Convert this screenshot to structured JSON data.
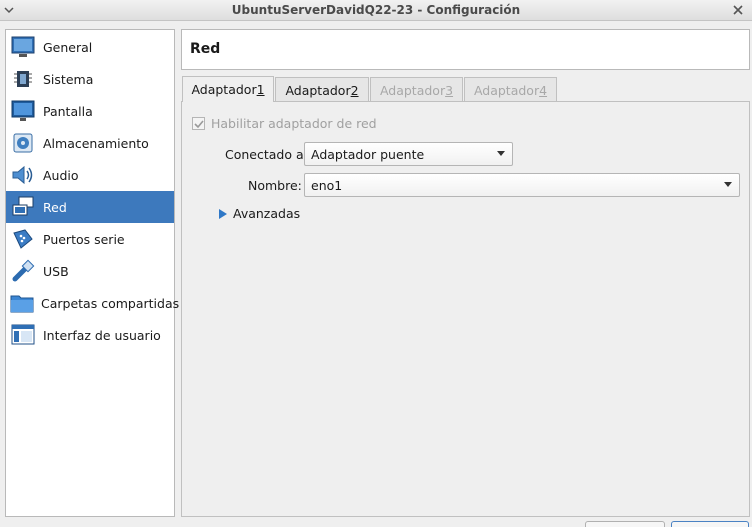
{
  "window": {
    "title": "UbuntuServerDavidQ22-23 - Configuración"
  },
  "sidebar": {
    "items": [
      {
        "label": "General",
        "icon": "general-icon"
      },
      {
        "label": "Sistema",
        "icon": "chip-icon"
      },
      {
        "label": "Pantalla",
        "icon": "monitor-icon"
      },
      {
        "label": "Almacenamiento",
        "icon": "disk-icon"
      },
      {
        "label": "Audio",
        "icon": "speaker-icon"
      },
      {
        "label": "Red",
        "icon": "network-icon",
        "selected": true
      },
      {
        "label": "Puertos serie",
        "icon": "serial-port-icon"
      },
      {
        "label": "USB",
        "icon": "usb-icon"
      },
      {
        "label": "Carpetas compartidas",
        "icon": "folder-icon"
      },
      {
        "label": "Interfaz de usuario",
        "icon": "ui-icon"
      }
    ]
  },
  "header": {
    "title": "Red"
  },
  "tabs": [
    {
      "pre": "Adaptador ",
      "u": "1",
      "state": "active"
    },
    {
      "pre": "Adaptador ",
      "u": "2",
      "state": "enabled"
    },
    {
      "pre": "Adaptador ",
      "u": "3",
      "state": "disabled"
    },
    {
      "pre": "Adaptador ",
      "u": "4",
      "state": "disabled"
    }
  ],
  "form": {
    "enable_label": "Habilitar adaptador de red",
    "enable_checked": true,
    "attached_label": "Conectado a:",
    "attached_value": "Adaptador puente",
    "name_label": "Nombre:",
    "name_value": "eno1",
    "advanced_label": "Avanzadas"
  },
  "colors": {
    "accent": "#3d79bd",
    "disabled_text": "#a0a0a0"
  }
}
